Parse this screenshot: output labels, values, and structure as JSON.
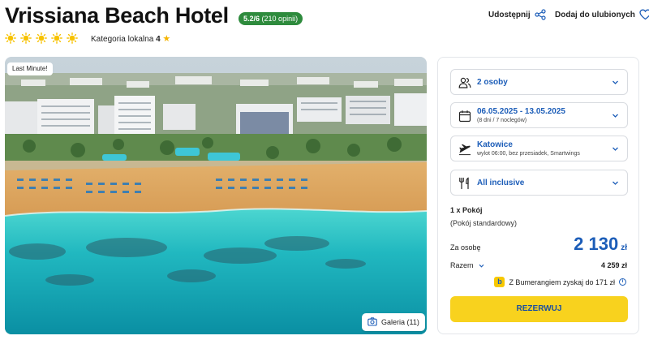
{
  "hotel": {
    "name": "Vrissiana Beach Hotel",
    "rating": "5.2/6",
    "rating_count": "(210 opinii)",
    "category_label": "Kategoria lokalna",
    "category_value": "4",
    "sun_count": 5
  },
  "actions": {
    "share_label": "Udostępnij",
    "favorite_label": "Dodaj do ulubionych"
  },
  "photo": {
    "badge": "Last Minute!",
    "gallery_label": "Galeria (11)"
  },
  "booking": {
    "persons": "2 osoby",
    "dates": "06.05.2025 - 13.05.2025",
    "dates_sub": "(8 dni / 7 noclegów)",
    "departure_city": "Katowice",
    "departure_sub": "wylot 06:00, bez przesiadek, Smartwings",
    "board": "All inclusive",
    "room_count": "1 x Pokój",
    "room_type": "(Pokój standardowy)",
    "per_person_label": "Za osobę",
    "per_person_price": "2 130",
    "currency": "zł",
    "total_label": "Razem",
    "total_price": "4 259 zł",
    "bumerang_text": "Z Bumerangiem zyskaj do 171 zł",
    "reserve_label": "REZERWUJ"
  },
  "colors": {
    "accent_blue": "#1c5db8",
    "rating_green": "#2e8b3d",
    "reserve_yellow": "#f8d21e",
    "sun_yellow": "#f7c200"
  }
}
